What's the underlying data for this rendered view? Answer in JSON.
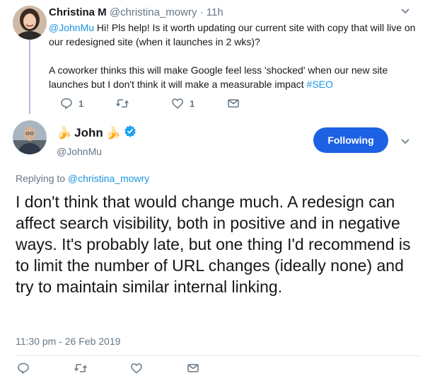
{
  "parent_tweet": {
    "display_name": "Christina M",
    "handle": "@christina_mowry",
    "separator": " · ",
    "time": "11h",
    "mention": "@JohnMu",
    "text_line1": " Hi! Pls help! Is it worth updating our current site with copy that will live on our redesigned site (when it launches in 2 wks)?",
    "text_para2": "A coworker thinks this will make Google feel less 'shocked' when our new site launches but I don't think it will make a measurable impact ",
    "hashtag": "#SEO",
    "reply_count": "1",
    "like_count": "1"
  },
  "main_tweet": {
    "name": "John",
    "name_emoji_left": "🍌",
    "name_emoji_right": "🍌",
    "handle": "@JohnMu",
    "follow_label": "Following",
    "replying_prefix": "Replying to ",
    "replying_to": "@christina_mowry",
    "text": "I don't think that would change much. A redesign can affect search visibility, both in positive and in negative ways. It's probably late, but one thing I'd recommend is to limit the number of URL changes (ideally none) and try to maintain similar internal linking.",
    "timestamp": "11:30 pm - 26 Feb 2019"
  },
  "colors": {
    "link": "#1b95e0",
    "button": "#1c61e3",
    "muted": "#657786",
    "verified": "#1da1f2",
    "thread_line": "#c4b5e8"
  },
  "icons": [
    "reply-icon",
    "retweet-icon",
    "like-icon",
    "message-icon",
    "chevron-down-icon",
    "verified-badge-icon",
    "banana-emoji-icon"
  ]
}
